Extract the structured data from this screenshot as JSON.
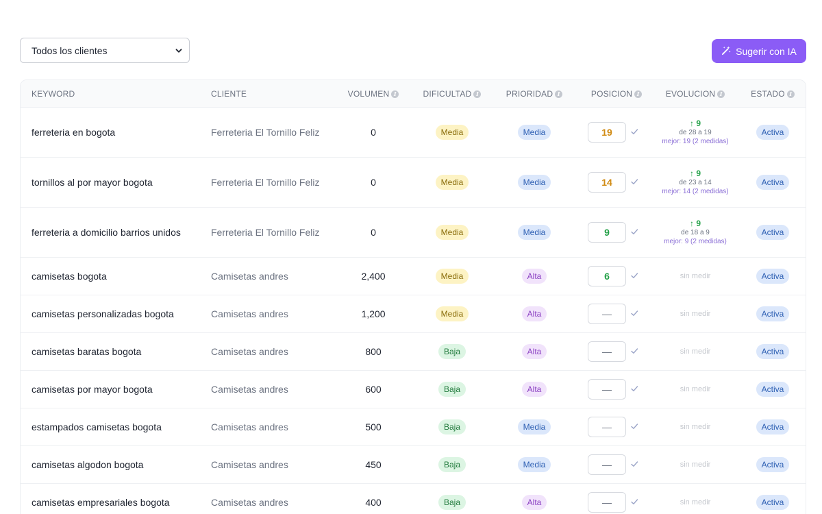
{
  "filter": {
    "selected": "Todos los clientes"
  },
  "ai_button": {
    "label": "Sugerir con IA"
  },
  "table": {
    "headers": {
      "keyword": "KEYWORD",
      "cliente": "CLIENTE",
      "volumen": "VOLUMEN",
      "dificultad": "DIFICULTAD",
      "prioridad": "PRIORIDAD",
      "posicion": "POSICION",
      "evolucion": "EVOLUCION",
      "estado": "ESTADO"
    },
    "rows": [
      {
        "keyword": "ferreteria en bogota",
        "cliente": "Ferreteria El Tornillo Feliz",
        "volumen": "0",
        "dificultad": "Media",
        "prioridad": "Media",
        "posicion": "19",
        "pos_color": "orange",
        "evo_main": "↑ 9",
        "evo_sub": "de 28 a 19",
        "evo_best": "mejor: 19 (2 medidas)",
        "estado": "Activa"
      },
      {
        "keyword": "tornillos al por mayor bogota",
        "cliente": "Ferreteria El Tornillo Feliz",
        "volumen": "0",
        "dificultad": "Media",
        "prioridad": "Media",
        "posicion": "14",
        "pos_color": "orange",
        "evo_main": "↑ 9",
        "evo_sub": "de 23 a 14",
        "evo_best": "mejor: 14 (2 medidas)",
        "estado": "Activa"
      },
      {
        "keyword": "ferreteria a domicilio barrios unidos",
        "cliente": "Ferreteria El Tornillo Feliz",
        "volumen": "0",
        "dificultad": "Media",
        "prioridad": "Media",
        "posicion": "9",
        "pos_color": "green",
        "evo_main": "↑ 9",
        "evo_sub": "de 18 a 9",
        "evo_best": "mejor: 9 (2 medidas)",
        "estado": "Activa"
      },
      {
        "keyword": "camisetas bogota",
        "cliente": "Camisetas andres",
        "volumen": "2,400",
        "dificultad": "Media",
        "prioridad": "Alta",
        "posicion": "6",
        "pos_color": "green",
        "evo_none": "sin medir",
        "estado": "Activa"
      },
      {
        "keyword": "camisetas personalizadas bogota",
        "cliente": "Camisetas andres",
        "volumen": "1,200",
        "dificultad": "Media",
        "prioridad": "Alta",
        "posicion": "—",
        "pos_color": "empty",
        "evo_none": "sin medir",
        "estado": "Activa"
      },
      {
        "keyword": "camisetas baratas bogota",
        "cliente": "Camisetas andres",
        "volumen": "800",
        "dificultad": "Baja",
        "prioridad": "Alta",
        "posicion": "—",
        "pos_color": "empty",
        "evo_none": "sin medir",
        "estado": "Activa"
      },
      {
        "keyword": "camisetas por mayor bogota",
        "cliente": "Camisetas andres",
        "volumen": "600",
        "dificultad": "Baja",
        "prioridad": "Alta",
        "posicion": "—",
        "pos_color": "empty",
        "evo_none": "sin medir",
        "estado": "Activa"
      },
      {
        "keyword": "estampados camisetas bogota",
        "cliente": "Camisetas andres",
        "volumen": "500",
        "dificultad": "Baja",
        "prioridad": "Media",
        "posicion": "—",
        "pos_color": "empty",
        "evo_none": "sin medir",
        "estado": "Activa"
      },
      {
        "keyword": "camisetas algodon bogota",
        "cliente": "Camisetas andres",
        "volumen": "450",
        "dificultad": "Baja",
        "prioridad": "Media",
        "posicion": "—",
        "pos_color": "empty",
        "evo_none": "sin medir",
        "estado": "Activa"
      },
      {
        "keyword": "camisetas empresariales bogota",
        "cliente": "Camisetas andres",
        "volumen": "400",
        "dificultad": "Baja",
        "prioridad": "Alta",
        "posicion": "—",
        "pos_color": "empty",
        "evo_none": "sin medir",
        "estado": "Activa"
      }
    ]
  },
  "icons": {
    "select": "chevron-down-icon",
    "ai": "magic-wand-icon",
    "info": "info-icon",
    "check": "check-icon"
  },
  "colors": {
    "accent": "#8b5cf6",
    "media": "#fdf3c4",
    "baja": "#dcf5e3",
    "alta": "#f1e3fb",
    "activa": "#dbe7fb",
    "pos_orange": "#d08a12",
    "pos_green": "#24a148"
  }
}
